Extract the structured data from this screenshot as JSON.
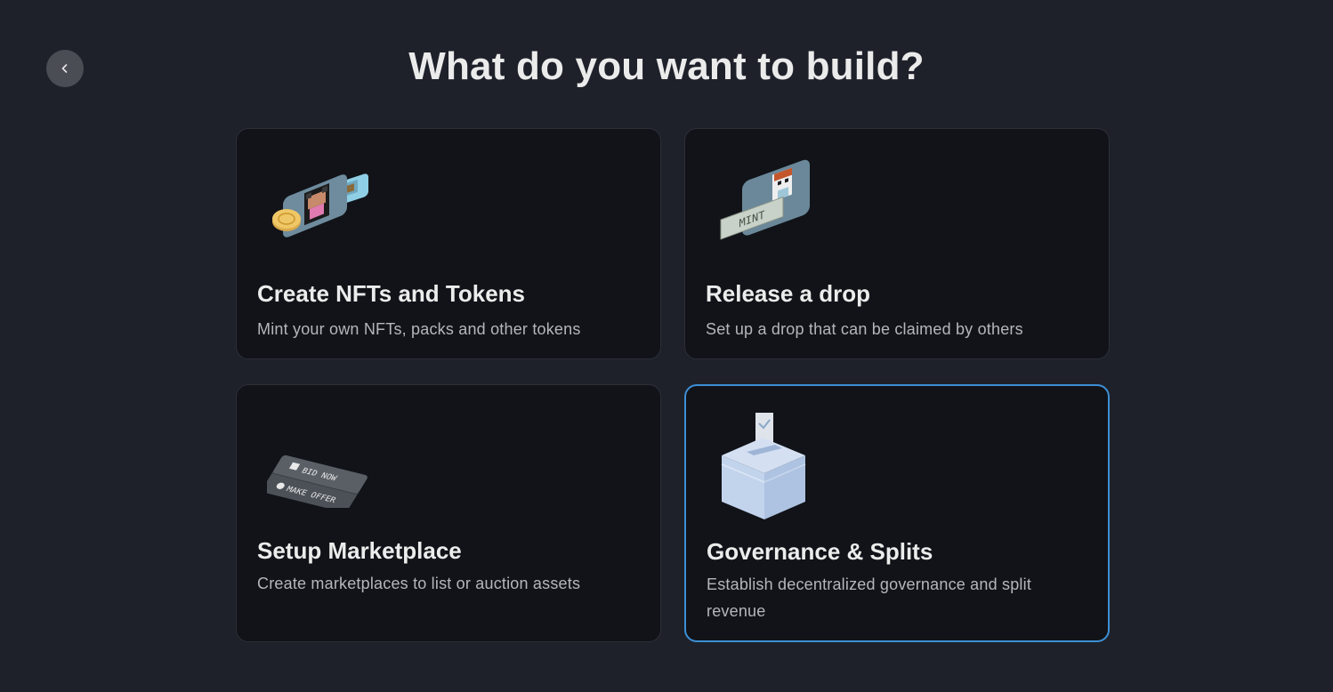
{
  "header": {
    "title": "What do you want to build?"
  },
  "back_button": {
    "icon": "chevron-left-icon"
  },
  "cards": [
    {
      "title": "Create NFTs and Tokens",
      "description": "Mint your own NFTs, packs and other tokens",
      "icon": "nft-tokens-illustration",
      "selected": false
    },
    {
      "title": "Release a drop",
      "description": "Set up a drop that can be claimed by others",
      "icon": "mint-drop-illustration",
      "illustration_text": "MINT",
      "selected": false
    },
    {
      "title": "Setup Marketplace",
      "description": "Create marketplaces to list or auction assets",
      "icon": "marketplace-illustration",
      "illustration_text": [
        "BID NOW",
        "MAKE OFFER"
      ],
      "selected": false
    },
    {
      "title": "Governance & Splits",
      "description": "Establish decentralized governance and split revenue",
      "icon": "ballot-box-illustration",
      "selected": true
    }
  ],
  "colors": {
    "background": "#1e212a",
    "card_background": "#111318",
    "selected_border": "#3d8fd6"
  }
}
